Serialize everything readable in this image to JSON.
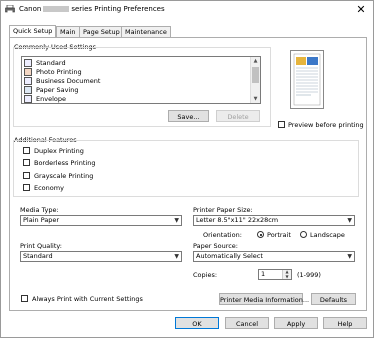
{
  "window": {
    "title_prefix": "Canon",
    "title_suffix": "series Printing Preferences"
  },
  "tabs": [
    {
      "label": "Quick Setup"
    },
    {
      "label": "Main"
    },
    {
      "label": "Page Setup"
    },
    {
      "label": "Maintenance"
    }
  ],
  "commonly_used": {
    "label": "Commonly Used Settings",
    "items": [
      {
        "label": "Standard"
      },
      {
        "label": "Photo Printing"
      },
      {
        "label": "Business Document"
      },
      {
        "label": "Paper Saving"
      },
      {
        "label": "Envelope"
      }
    ],
    "save_label": "Save...",
    "delete_label": "Delete"
  },
  "preview": {
    "checkbox_label": "Preview before printing"
  },
  "additional_features": {
    "label": "Additional Features",
    "items": [
      {
        "label": "Duplex Printing"
      },
      {
        "label": "Borderless Printing"
      },
      {
        "label": "Grayscale Printing"
      },
      {
        "label": "Economy"
      }
    ]
  },
  "media_type": {
    "label": "Media Type:",
    "value": "Plain Paper"
  },
  "printer_paper_size": {
    "label": "Printer Paper Size:",
    "value": "Letter 8.5\"x11\" 22x28cm"
  },
  "orientation": {
    "label": "Orientation:",
    "portrait": "Portrait",
    "landscape": "Landscape",
    "selected": "Portrait"
  },
  "print_quality": {
    "label": "Print Quality:",
    "value": "Standard"
  },
  "paper_source": {
    "label": "Paper Source:",
    "value": "Automatically Select"
  },
  "copies": {
    "label": "Copies:",
    "value": "1",
    "range": "(1-999)"
  },
  "footer": {
    "always_print_label": "Always Print with Current Settings",
    "printer_media_info_label": "Printer Media Information...",
    "defaults_label": "Defaults"
  },
  "dialog_buttons": {
    "ok": "OK",
    "cancel": "Cancel",
    "apply": "Apply",
    "help": "Help"
  }
}
